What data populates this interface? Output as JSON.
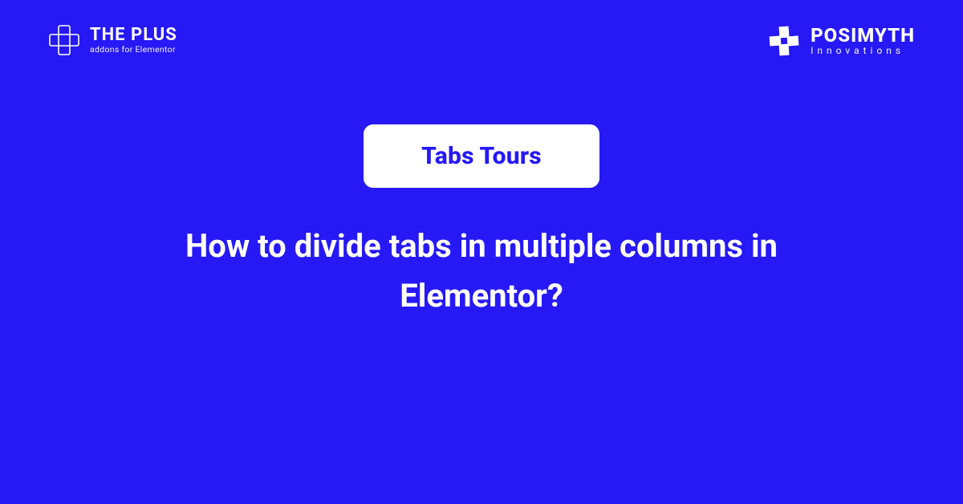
{
  "brand_left": {
    "title": "THE PLUS",
    "subtitle": "addons for Elementor"
  },
  "brand_right": {
    "title": "POSIMYTH",
    "subtitle": "Innovations"
  },
  "badge": {
    "label": "Tabs Tours"
  },
  "headline": "How to divide tabs in multiple columns in Elementor?"
}
